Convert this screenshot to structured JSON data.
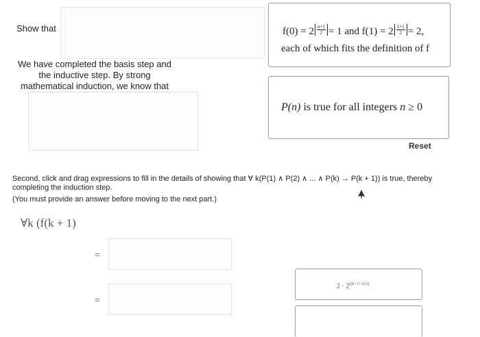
{
  "step_basis": {
    "label": "Show that",
    "card_line1": {
      "f0": "f(0) = 2",
      "f0_frac_num": "n+1",
      "f0_frac_den": "2",
      "f0_result": "= 1 and ",
      "f1": "f(1) = 2",
      "f1_frac_num": "1+1",
      "f1_frac_den": "2",
      "f1_result": "= 2,"
    },
    "card_line2": "each of which fits the definition of f"
  },
  "step_conclusion": {
    "label": "We have completed the basis step and the inductive step. By strong mathematical induction, we know that",
    "card_text_pre": "P(n)",
    "card_text_mid": " is true for all integers ",
    "card_text_var": "n",
    "card_text_post": " ≥ 0"
  },
  "reset_label": "Reset",
  "instructions": {
    "line1": "Second, click and drag expressions to fill in the details of showing that ∀ k(P(1) ∧ P(2) ∧ ... ∧ P(k) → P(k + 1)) is true, thereby",
    "line2": "completing the induction step.",
    "line3": "(You must provide an answer before moving to the next part.)"
  },
  "proof": {
    "start_expr": "∀k (f(k + 1)",
    "equals_1": "=",
    "equals_2": "="
  },
  "draggable_card": {
    "text": "2 · 2",
    "exponent": "⌊(k−1+1)/2⌋"
  }
}
